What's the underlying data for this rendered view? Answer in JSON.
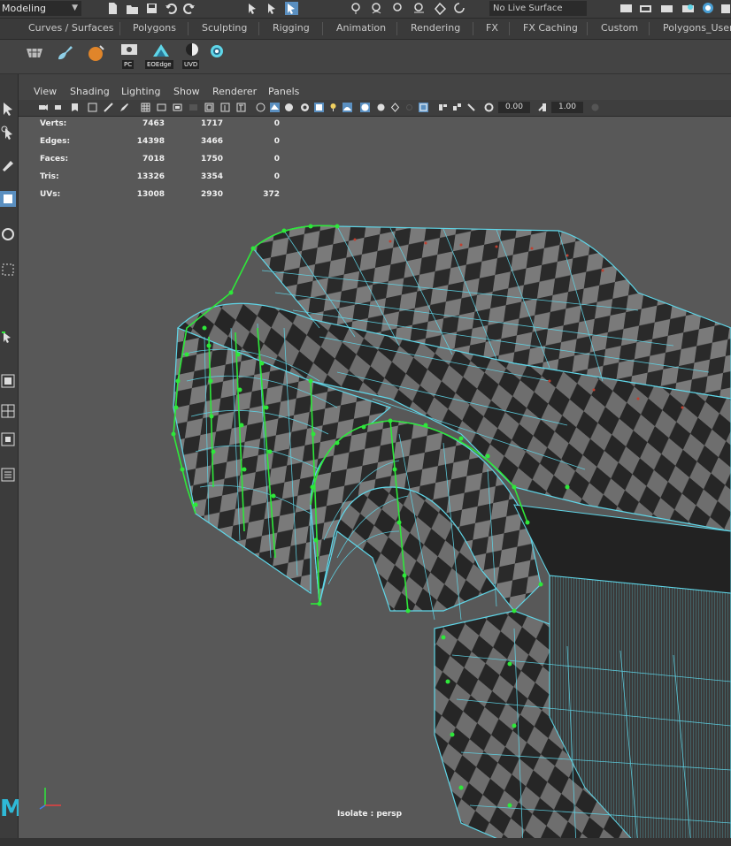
{
  "topbar": {
    "mode": "Modeling",
    "live_surface": "No Live Surface"
  },
  "shelf": {
    "tabs": [
      "Curves / Surfaces",
      "Polygons",
      "Sculpting",
      "Rigging",
      "Animation",
      "Rendering",
      "FX",
      "FX Caching",
      "Custom",
      "Polygons_User"
    ],
    "icons": [
      {
        "name": "PC",
        "label": "PC"
      },
      {
        "name": "EOEdge",
        "label": "EOEdge"
      },
      {
        "name": "UVD",
        "label": "UVD"
      }
    ]
  },
  "viewport": {
    "menus": [
      "View",
      "Shading",
      "Lighting",
      "Show",
      "Renderer",
      "Panels"
    ],
    "field1": "0.00",
    "field2": "1.00",
    "camera_label": "Isolate : persp"
  },
  "hud": {
    "rows": [
      {
        "label": "Verts:",
        "c1": "7463",
        "c2": "1717",
        "c3": "0"
      },
      {
        "label": "Edges:",
        "c1": "14398",
        "c2": "3466",
        "c3": "0"
      },
      {
        "label": "Faces:",
        "c1": "7018",
        "c2": "1750",
        "c3": "0"
      },
      {
        "label": "Tris:",
        "c1": "13326",
        "c2": "3354",
        "c3": "0"
      },
      {
        "label": "UVs:",
        "c1": "13008",
        "c2": "2930",
        "c3": "372"
      }
    ]
  },
  "colors": {
    "wire": "#5fd6e8",
    "vertex": "#2ee83a",
    "panel": "#444444",
    "viewport_bg": "#585858"
  }
}
